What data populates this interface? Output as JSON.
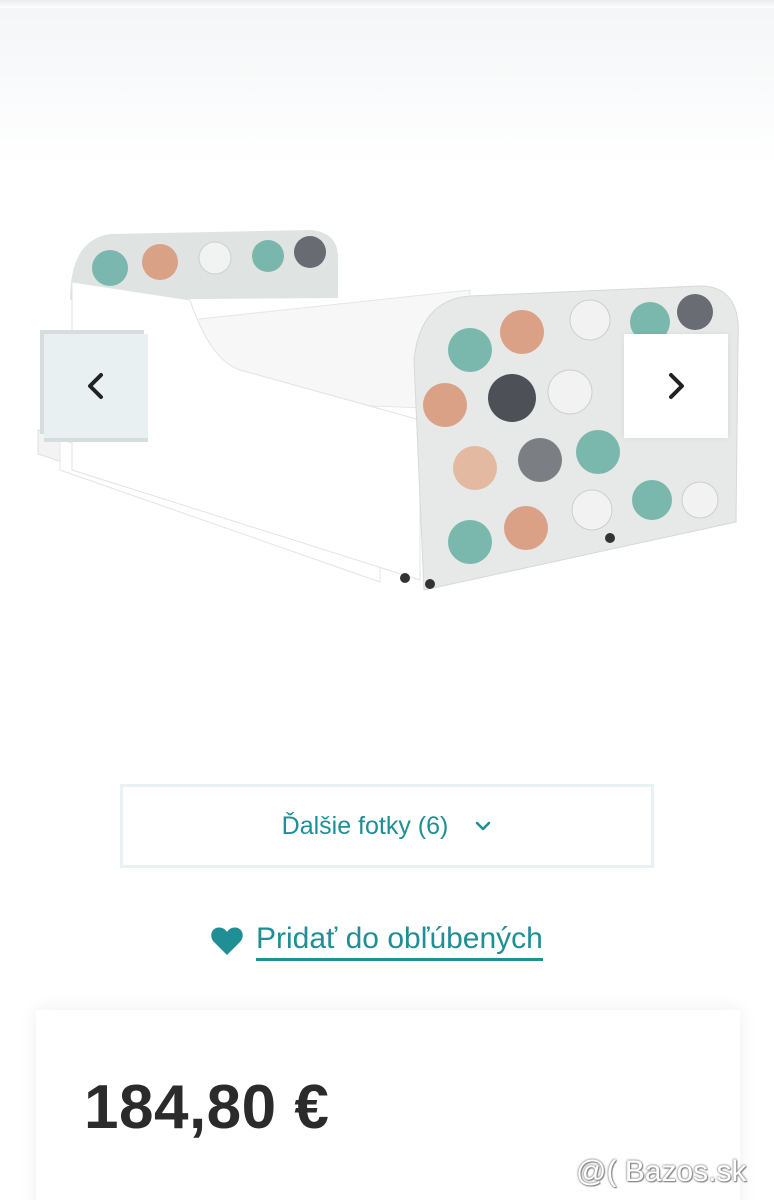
{
  "gallery": {
    "image_alt_icon": "bed-product-photo",
    "prev_icon": "chevron-left-icon",
    "next_icon": "chevron-right-icon"
  },
  "more_photos": {
    "label": "Ďalšie fotky (6)",
    "icon": "chevron-down-icon"
  },
  "favorite": {
    "label": "Pridať do obľúbených",
    "icon": "heart-icon"
  },
  "price": {
    "value": "184,80 €"
  },
  "watermark": {
    "text": "@( Bazos.sk"
  },
  "colors": {
    "accent": "#1f8e95",
    "price_text": "#2b2b2b",
    "border_light": "#e9f2f3"
  }
}
